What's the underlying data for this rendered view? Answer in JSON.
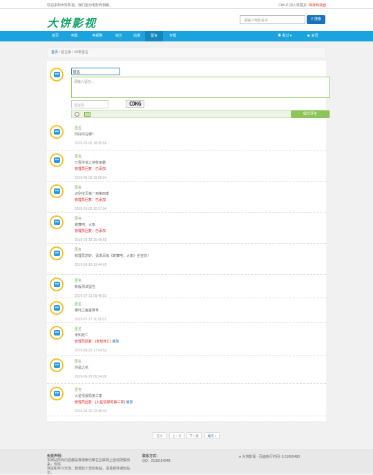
{
  "topbar": {
    "left": "欢迎来到大饼影视，我们因为电影而相聚。",
    "right_prefix": "Ctrl+D 加入收藏夹 -",
    "right_link": "保存到桌面"
  },
  "header": {
    "logo": "大饼影视",
    "search_placeholder": "请输入电影名字",
    "search_button": "搜索"
  },
  "nav": {
    "items": [
      "首页",
      "电影",
      "电视剧",
      "综艺",
      "动漫",
      "留言",
      "专题"
    ],
    "active_index": 5,
    "right_1": "看过",
    "right_2": "会员"
  },
  "breadcrumb": {
    "home": "首页",
    "sep": "/",
    "page": "留言板",
    "count": "68条留言"
  },
  "form": {
    "nickname": "匿名",
    "content_placeholder": "请输入留言...",
    "captcha_placeholder": "验证码",
    "captcha_code": "CDKG",
    "submit": "提交评论"
  },
  "comments": [
    {
      "name": "匿名",
      "text": "你好你在哪？",
      "reply_label": "",
      "reply": "",
      "fix": "",
      "time": "2019-06-06 18:35:58"
    },
    {
      "name": "匿名",
      "text": "已看传说之将校争霸",
      "reply_label": "管理员回复：",
      "reply": "已添加",
      "fix": "",
      "time": "2019-06-03 19:05:54"
    },
    {
      "name": "匿名",
      "text": "识别宝贝第一到第四季",
      "reply_label": "管理员回复：",
      "reply": "已添加",
      "fix": "",
      "time": "2019-06-03 10:37:04"
    },
    {
      "name": "匿名",
      "text": "跳舞吧，大象",
      "reply_label": "管理员回复：",
      "reply": "已添加",
      "fix": "",
      "time": "2019-06-18 15:49:55"
    },
    {
      "name": "匿名",
      "text": "管理员您好，请求添加《跳舞吧，大象》全宣前！",
      "reply_label": "",
      "reply": "",
      "fix": "",
      "time": "2019-06-19 13:44:43"
    },
    {
      "name": "匿名",
      "text": "新版测试留言",
      "reply_label": "",
      "reply": "",
      "fix": "",
      "time": "2019-07-31 09:46:51"
    },
    {
      "name": "匿名",
      "text": "哪吒之魔童降世",
      "reply_label": "",
      "reply": "",
      "fix": "",
      "time": "2019-07-17 11:31:01"
    },
    {
      "name": "匿名",
      "text": "未知死亡",
      "reply_label": "管理员回复：",
      "reply": "[未知死亡]",
      "fix": "播放",
      "time": "2019-06-29 17:54:52"
    },
    {
      "name": "匿名",
      "text": "你是之花",
      "reply_label": "",
      "reply": "",
      "fix": "",
      "time": "2019-06-29 00:34:05"
    },
    {
      "name": "匿名",
      "text": "火星情报局第三季",
      "reply_label": "管理员回复：",
      "reply": "[火星情报局第三季]",
      "fix": "播放",
      "time": "2019-06-26 22:48:33"
    }
  ],
  "pagination": {
    "first": "首页",
    "prev": "上一页",
    "next": "下一页",
    "last": "尾页 »"
  },
  "footer": {
    "c1_title": "免责声明：",
    "c1_line1": "本网站所有内容都是靠搜索引擎在互联网上自动搜集而来，仅供",
    "c1_line2": "测试和学习交流。若侵犯了您的权益，请发邮件通知站长。",
    "c2_title": "联系方式：",
    "c2_line1": "QQ：2108154648",
    "c3": "● 大饼影视 · 页面执行时间: 0.01000480"
  },
  "colors": {
    "nav": "#1aa3dc",
    "accent": "#1a73b8",
    "green": "#8cc55a",
    "red": "#dd2222"
  }
}
